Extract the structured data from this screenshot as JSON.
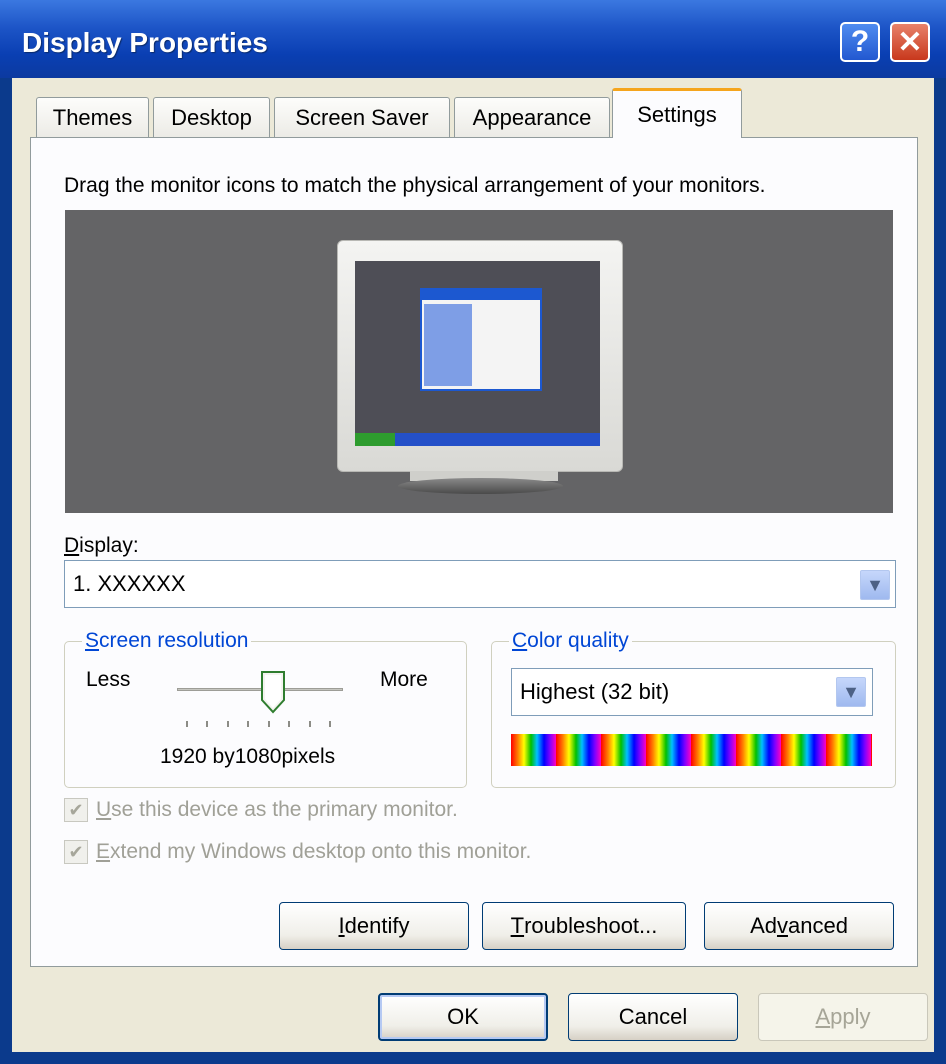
{
  "window": {
    "title": "Display Properties",
    "help_glyph": "?",
    "close_glyph": "✕"
  },
  "tabs": [
    {
      "label": "Themes"
    },
    {
      "label": "Desktop"
    },
    {
      "label": "Screen Saver"
    },
    {
      "label": "Appearance"
    },
    {
      "label": "Settings",
      "active": true
    }
  ],
  "settings": {
    "instruction": "Drag the monitor icons to match the physical arrangement of your monitors.",
    "display_label_mnemonic": "D",
    "display_label_rest": "isplay:",
    "display_value": "1. XXXXXX",
    "resolution": {
      "legend_mnemonic": "S",
      "legend_rest": "creen resolution",
      "less_label": "Less",
      "more_label": "More",
      "value_text": "1920 by1080pixels",
      "slider_position": 0.5
    },
    "color_quality": {
      "legend_mnemonic": "C",
      "legend_rest": "olor quality",
      "value": "Highest (32 bit)"
    },
    "checkboxes": [
      {
        "mnemonic": "U",
        "rest": "se this device as the primary monitor.",
        "checked": true,
        "enabled": false
      },
      {
        "mnemonic": "E",
        "rest": "xtend my Windows desktop onto this monitor.",
        "checked": true,
        "enabled": false
      }
    ],
    "buttons": {
      "identify": {
        "mnemonic": "I",
        "rest": "dentify"
      },
      "troubleshoot": {
        "mnemonic": "T",
        "rest": "roubleshoot..."
      },
      "advanced": {
        "pre": "Ad",
        "mnemonic": "v",
        "rest": "anced"
      }
    }
  },
  "dialog_buttons": {
    "ok": "OK",
    "cancel": "Cancel",
    "apply": {
      "mnemonic": "A",
      "rest": "pply"
    }
  },
  "icons": {
    "dropdown": "chevron-down-icon",
    "check": "checkmark-icon",
    "monitor": "monitor-icon"
  },
  "colors": {
    "title_bar": "#0a3fb3",
    "tab_accent": "#f5a51d",
    "legend_text": "#0046d5",
    "face": "#ece9d8"
  }
}
